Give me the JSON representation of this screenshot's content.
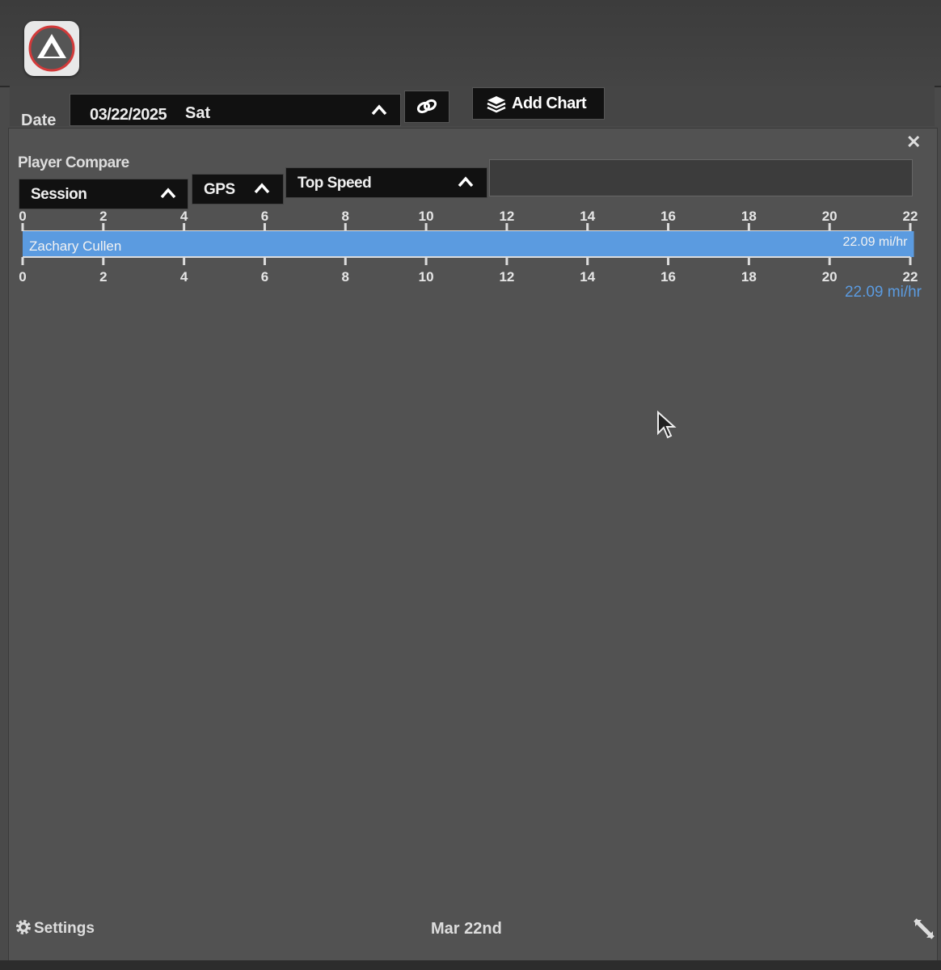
{
  "toolbar": {
    "date_label": "Date",
    "date_value": "03/22/2025",
    "date_day": "Sat",
    "link_icon": "link-icon",
    "add_chart_label": "Add Chart",
    "add_chart_icon": "layers-icon"
  },
  "panel": {
    "title": "Player Compare",
    "close_icon": "close-icon",
    "filters": {
      "session": "Session",
      "source": "GPS",
      "metric": "Top Speed"
    }
  },
  "chart_data": {
    "type": "bar",
    "orientation": "horizontal",
    "categories": [
      "Zachary Cullen"
    ],
    "values": [
      22.09
    ],
    "value_labels": [
      "22.09 mi/hr"
    ],
    "xlim": [
      0,
      22
    ],
    "x_ticks": [
      "0",
      "2",
      "4",
      "6",
      "8",
      "10",
      "12",
      "14",
      "16",
      "18",
      "20",
      "22"
    ],
    "total_label": "22.09 mi/hr",
    "bar_color": "#5b9be0"
  },
  "footer": {
    "settings_label": "Settings",
    "date": "Mar 22nd",
    "resize_icon": "resize-icon"
  },
  "colors": {
    "background": "#4a4a4a",
    "panel": "#525252",
    "control": "#111111",
    "accent": "#5b9be0",
    "logo_ring": "#d23a3a"
  }
}
